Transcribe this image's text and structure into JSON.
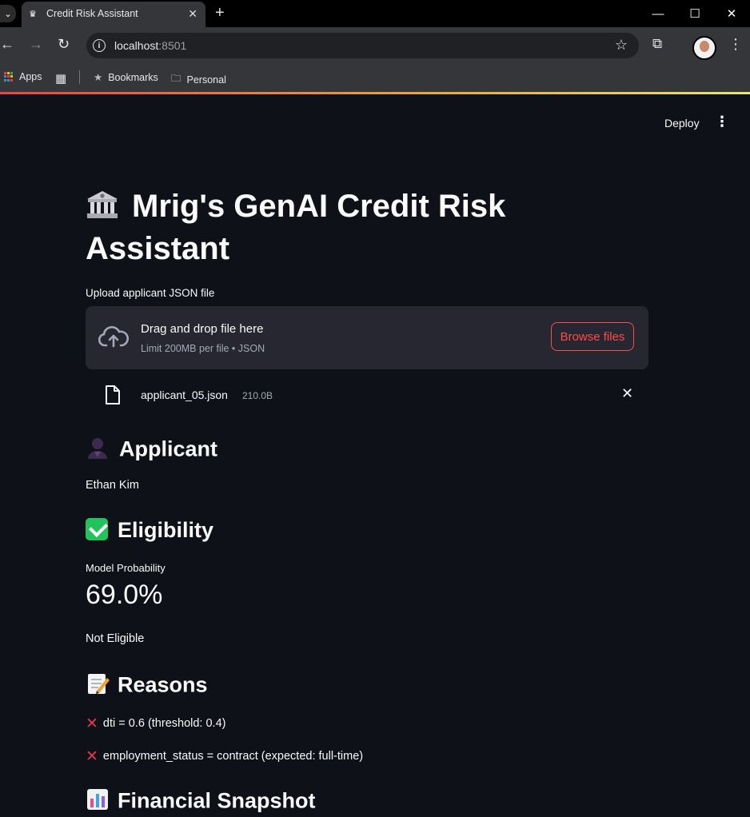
{
  "browser": {
    "tab_title": "Credit Risk Assistant",
    "url_host": "localhost",
    "url_port": ":8501",
    "bookmarks": [
      {
        "label": "Apps",
        "icon": "apps-grid-icon"
      },
      {
        "label": "Bookmarks",
        "icon": "star-icon"
      },
      {
        "label": "Personal",
        "icon": "folder-icon"
      }
    ]
  },
  "app_header": {
    "deploy_label": "Deploy"
  },
  "page": {
    "title": "Mrig's GenAI Credit Risk Assistant",
    "title_icon": "bank-icon"
  },
  "uploader": {
    "label": "Upload applicant JSON file",
    "drop_title": "Drag and drop file here",
    "drop_sub": "Limit 200MB per file • JSON",
    "browse_label": "Browse files",
    "file_name": "applicant_05.json",
    "file_size": "210.0B"
  },
  "applicant": {
    "heading": "Applicant",
    "heading_icon": "person-icon",
    "name": "Ethan Kim"
  },
  "eligibility": {
    "heading": "Eligibility",
    "heading_icon": "check-mark-icon",
    "metric_label": "Model Probability",
    "metric_value": "69.0%",
    "status": "Not Eligible"
  },
  "reasons": {
    "heading": "Reasons",
    "heading_icon": "memo-icon",
    "items": [
      "dti = 0.6 (threshold: 0.4)",
      "employment_status = contract (expected: full-time)"
    ]
  },
  "financial": {
    "heading": "Financial Snapshot",
    "heading_icon": "bar-chart-icon"
  },
  "colors": {
    "background": "#0e1117",
    "primary": "#ff4b4b",
    "dropzone": "#262730",
    "error_icon": "#e8344e",
    "success_icon": "#22c35d"
  }
}
